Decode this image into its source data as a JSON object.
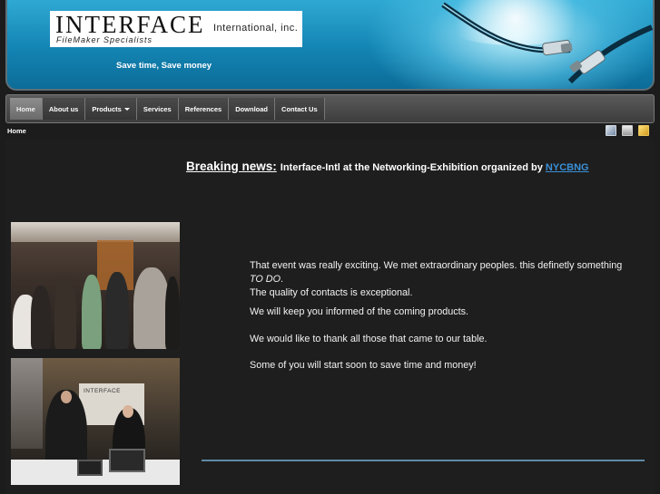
{
  "header": {
    "logo_main": "INTERFACE",
    "logo_suffix": "International, inc.",
    "logo_sub": "FileMaker Specialists",
    "tagline": "Save time, Save money"
  },
  "nav": {
    "items": [
      {
        "label": "Home",
        "active": true
      },
      {
        "label": "About us"
      },
      {
        "label": "Products",
        "dropdown": true
      },
      {
        "label": "Services"
      },
      {
        "label": "References"
      },
      {
        "label": "Download"
      },
      {
        "label": "Contact Us"
      }
    ]
  },
  "breadcrumb": "Home",
  "tools": [
    "pdf-icon",
    "print-icon",
    "email-icon"
  ],
  "article": {
    "breaking_label": "Breaking news:",
    "headline": "Interface-Intl at the Networking-Exhibition organized by",
    "headline_link": "NYCBNG",
    "p1_a": "That event was really exciting. We met extraordinary peoples. this definetly something",
    "p1_em": "TO DO",
    "p1_b": ".",
    "p2": "The quality of contacts is exceptional.",
    "p3": "We will keep you informed of the coming products.",
    "p4": "We would like to thank all those that came to our table.",
    "p5": "Some of you will start soon to save time and money!"
  },
  "photo2_sign": "INTERFACE",
  "colors": {
    "banner": "#1384b3",
    "link": "#3a8fd6",
    "rule": "#5f8aa6"
  }
}
